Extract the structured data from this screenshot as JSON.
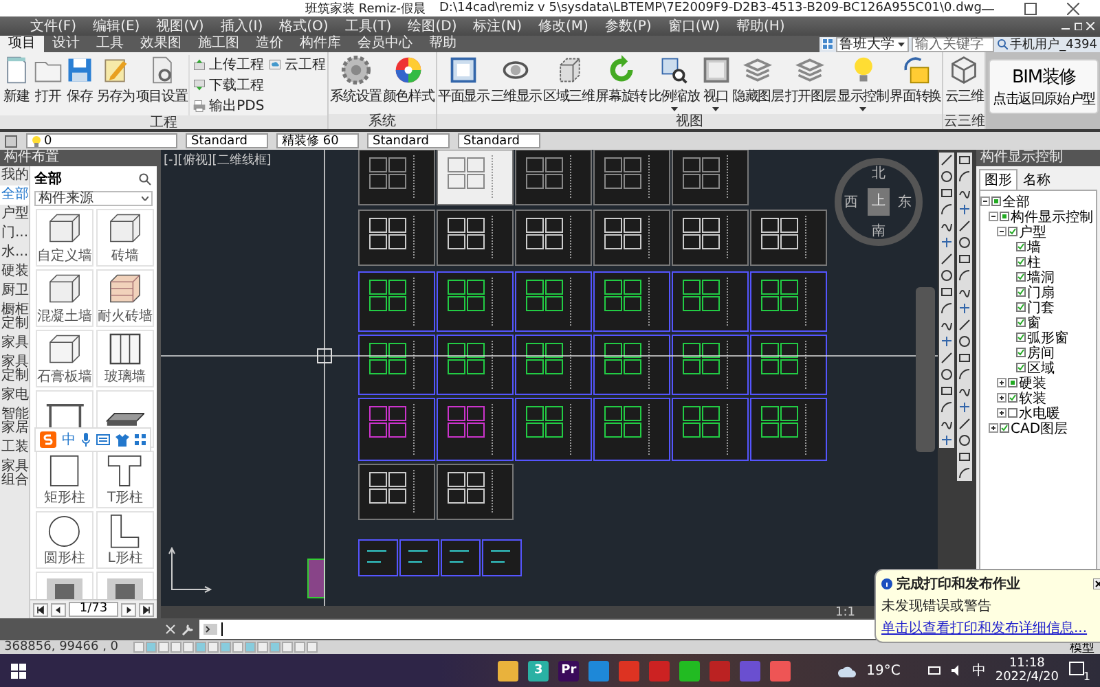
{
  "window": {
    "title": "班筑家装 Remiz-假晨",
    "path": "D:\\14cad\\remiz v 5\\sysdata\\LBTEMP\\7E2009F9-D2B3-4513-B209-BC126A955C01\\0.dwg"
  },
  "menu": [
    "文件(F)",
    "编辑(E)",
    "视图(V)",
    "插入(I)",
    "格式(O)",
    "工具(T)",
    "绘图(D)",
    "标注(N)",
    "修改(M)",
    "参数(P)",
    "窗口(W)",
    "帮助(H)"
  ],
  "ribbon": {
    "tabs": [
      {
        "label": "项目",
        "selected": true
      },
      {
        "label": "设计",
        "selected": false
      },
      {
        "label": "工具",
        "selected": false
      },
      {
        "label": "效果图",
        "selected": false
      },
      {
        "label": "施工图",
        "selected": false
      },
      {
        "label": "造价",
        "selected": false
      },
      {
        "label": "构件库",
        "selected": false
      },
      {
        "label": "会员中心",
        "selected": false
      },
      {
        "label": "帮助",
        "selected": false
      }
    ],
    "search": {
      "scope": "鲁班大学",
      "placeholder": "输入关键字"
    },
    "user": "手机用户_4394",
    "groups": [
      {
        "title": "工程",
        "buttons": [
          {
            "label": "新建",
            "kind": "new"
          },
          {
            "label": "打开",
            "kind": "open"
          },
          {
            "label": "保存",
            "kind": "save"
          },
          {
            "label": "另存为",
            "kind": "saveas"
          },
          {
            "label": "项目设置",
            "kind": "project"
          }
        ],
        "small_buttons": [
          {
            "label": "上传工程",
            "kind": "upload"
          },
          {
            "label": "下载工程",
            "kind": "download"
          },
          {
            "label": "输出PDS",
            "kind": "export"
          }
        ],
        "side_buttons": [
          {
            "label": "云工程",
            "kind": "cloud"
          }
        ]
      },
      {
        "title": "系统",
        "buttons": [
          {
            "label": "系统设置",
            "kind": "gear"
          },
          {
            "label": "颜色样式",
            "kind": "palette"
          }
        ]
      },
      {
        "title": "视图",
        "buttons": [
          {
            "label": "平面显示",
            "kind": "plan"
          },
          {
            "label": "三维显示",
            "kind": "orbit"
          },
          {
            "label": "区域三维",
            "kind": "region"
          },
          {
            "label": "屏幕旋转",
            "kind": "rotate"
          },
          {
            "label": "比例缩放",
            "kind": "zoom",
            "dropdown": true
          },
          {
            "label": "视口",
            "kind": "viewport",
            "dropdown": true
          },
          {
            "label": "隐藏图层",
            "kind": "layers"
          },
          {
            "label": "打开图层",
            "kind": "layers"
          },
          {
            "label": "显示控制",
            "kind": "bulb",
            "dropdown": true
          },
          {
            "label": "界面转换",
            "kind": "switch"
          }
        ]
      },
      {
        "title": "云三维",
        "buttons": [
          {
            "label": "云三维",
            "kind": "cube"
          }
        ]
      }
    ],
    "bim_button": {
      "title": "BIM装修",
      "subtitle": "点击返回原始户型"
    }
  },
  "toolbar": {
    "layer": "0",
    "styles": [
      "Standard",
      "精装修 60",
      "Standard",
      "Standard"
    ]
  },
  "left_panel": {
    "title": "构件布置",
    "tabs": [
      {
        "label": "我的",
        "selected": false
      },
      {
        "label": "全部",
        "selected": true
      },
      {
        "label": "户型",
        "selected": false
      },
      {
        "label": "门...",
        "selected": false
      },
      {
        "label": "水...",
        "selected": false
      },
      {
        "label": "硬装",
        "selected": false
      },
      {
        "label": "厨卫",
        "selected": false
      },
      {
        "label": "橱柜定制",
        "selected": false
      },
      {
        "label": "家具",
        "selected": false
      },
      {
        "label": "家具定制",
        "selected": false
      },
      {
        "label": "家电",
        "selected": false
      },
      {
        "label": "智能家居",
        "selected": false
      },
      {
        "label": "工装",
        "selected": false
      },
      {
        "label": "家具组合",
        "selected": false
      }
    ],
    "heading": "全部",
    "filter": "构件来源",
    "items": [
      {
        "label": "自定义墙",
        "kind": "wall"
      },
      {
        "label": "砖墙",
        "kind": "wall"
      },
      {
        "label": "混凝土墙",
        "kind": "wall"
      },
      {
        "label": "耐火砖墙",
        "kind": "brick"
      },
      {
        "label": "石膏板墙",
        "kind": "board"
      },
      {
        "label": "玻璃墙",
        "kind": "glass"
      },
      {
        "kind": "table"
      },
      {
        "kind": "slab"
      },
      {
        "label": "矩形柱",
        "kind": "square"
      },
      {
        "label": "T形柱",
        "kind": "tee"
      },
      {
        "label": "圆形柱",
        "kind": "round"
      },
      {
        "label": "L形柱",
        "kind": "ell"
      },
      {
        "kind": "door"
      },
      {
        "kind": "door"
      }
    ],
    "page": "1/73"
  },
  "ime_toolbar": {
    "mode": "中"
  },
  "canvas": {
    "viewport_label": "[-][俯视][二维线框]",
    "compass": {
      "north": "北",
      "south": "南",
      "west": "西",
      "east": "东",
      "top": "上"
    },
    "scale": "1:1"
  },
  "right_panel": {
    "title": "构件显示控制",
    "tabs": [
      {
        "label": "图形",
        "selected": true
      },
      {
        "label": "名称",
        "selected": false
      }
    ],
    "tree": [
      {
        "label": "全部",
        "checked": true,
        "partial": true,
        "expanded": true,
        "children": [
          {
            "label": "构件显示控制",
            "checked": true,
            "partial": true,
            "expanded": true,
            "children": [
              {
                "label": "户型",
                "checked": true,
                "partial": false,
                "expanded": true,
                "children": [
                  {
                    "label": "墙",
                    "checked": true,
                    "partial": false
                  },
                  {
                    "label": "柱",
                    "checked": true,
                    "partial": false
                  },
                  {
                    "label": "墙洞",
                    "checked": true,
                    "partial": false
                  },
                  {
                    "label": "门扇",
                    "checked": true,
                    "partial": false
                  },
                  {
                    "label": "门套",
                    "checked": true,
                    "partial": false
                  },
                  {
                    "label": "窗",
                    "checked": true,
                    "partial": false
                  },
                  {
                    "label": "弧形窗",
                    "checked": true,
                    "partial": false
                  },
                  {
                    "label": "房间",
                    "checked": true,
                    "partial": false
                  },
                  {
                    "label": "区域",
                    "checked": true,
                    "partial": false
                  }
                ]
              },
              {
                "label": "硬装",
                "checked": true,
                "partial": true,
                "expanded": false
              },
              {
                "label": "软装",
                "checked": true,
                "partial": false,
                "expanded": false
              },
              {
                "label": "水电暖",
                "checked": false,
                "expanded": false
              }
            ]
          },
          {
            "label": "CAD图层",
            "checked": true,
            "partial": false,
            "expanded": false
          }
        ]
      }
    ]
  },
  "notification": {
    "title": "完成打印和发布作业",
    "message": "未发现错误或警告",
    "link": "单击以查看打印和发布详细信息..."
  },
  "status_bar": {
    "coordinates": "368856, 99466 , 0",
    "tools": [
      {
        "on": false
      },
      {
        "on": true
      },
      {
        "on": false
      },
      {
        "on": false
      },
      {
        "on": false
      },
      {
        "on": true
      },
      {
        "on": false
      },
      {
        "on": true
      },
      {
        "on": false
      },
      {
        "on": true
      },
      {
        "on": false
      },
      {
        "on": true
      },
      {
        "on": false
      },
      {
        "on": false
      },
      {
        "on": false
      }
    ],
    "space": "模型"
  },
  "taskbar": {
    "apps": [
      {
        "kind": "folder"
      },
      {
        "kind": "green",
        "glyph": "3"
      },
      {
        "kind": "purple",
        "glyph": "Pr"
      },
      {
        "kind": "edge"
      },
      {
        "kind": "red"
      },
      {
        "kind": "w"
      },
      {
        "kind": "chat"
      },
      {
        "kind": "cad"
      },
      {
        "kind": "p"
      },
      {
        "kind": "sogou"
      }
    ],
    "weather": "19°C",
    "ime": "中",
    "time": "11:18",
    "date": "2022/4/20",
    "notifications": "1"
  }
}
